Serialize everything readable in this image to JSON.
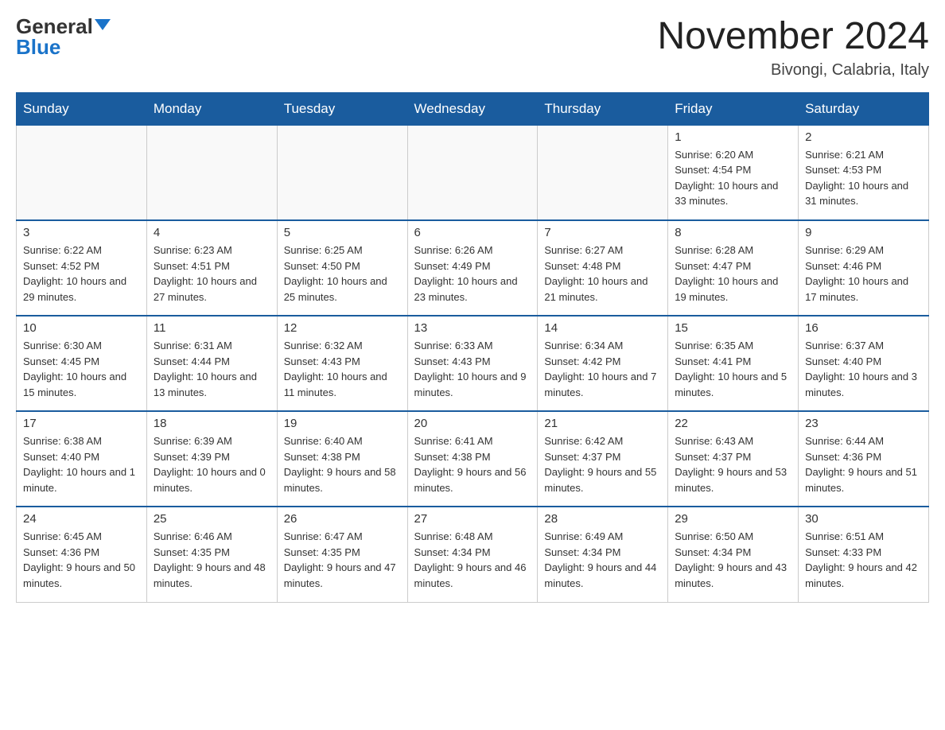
{
  "header": {
    "logo_general": "General",
    "logo_blue": "Blue",
    "month_title": "November 2024",
    "location": "Bivongi, Calabria, Italy"
  },
  "days_of_week": [
    "Sunday",
    "Monday",
    "Tuesday",
    "Wednesday",
    "Thursday",
    "Friday",
    "Saturday"
  ],
  "weeks": [
    [
      {
        "day": "",
        "info": ""
      },
      {
        "day": "",
        "info": ""
      },
      {
        "day": "",
        "info": ""
      },
      {
        "day": "",
        "info": ""
      },
      {
        "day": "",
        "info": ""
      },
      {
        "day": "1",
        "info": "Sunrise: 6:20 AM\nSunset: 4:54 PM\nDaylight: 10 hours and 33 minutes."
      },
      {
        "day": "2",
        "info": "Sunrise: 6:21 AM\nSunset: 4:53 PM\nDaylight: 10 hours and 31 minutes."
      }
    ],
    [
      {
        "day": "3",
        "info": "Sunrise: 6:22 AM\nSunset: 4:52 PM\nDaylight: 10 hours and 29 minutes."
      },
      {
        "day": "4",
        "info": "Sunrise: 6:23 AM\nSunset: 4:51 PM\nDaylight: 10 hours and 27 minutes."
      },
      {
        "day": "5",
        "info": "Sunrise: 6:25 AM\nSunset: 4:50 PM\nDaylight: 10 hours and 25 minutes."
      },
      {
        "day": "6",
        "info": "Sunrise: 6:26 AM\nSunset: 4:49 PM\nDaylight: 10 hours and 23 minutes."
      },
      {
        "day": "7",
        "info": "Sunrise: 6:27 AM\nSunset: 4:48 PM\nDaylight: 10 hours and 21 minutes."
      },
      {
        "day": "8",
        "info": "Sunrise: 6:28 AM\nSunset: 4:47 PM\nDaylight: 10 hours and 19 minutes."
      },
      {
        "day": "9",
        "info": "Sunrise: 6:29 AM\nSunset: 4:46 PM\nDaylight: 10 hours and 17 minutes."
      }
    ],
    [
      {
        "day": "10",
        "info": "Sunrise: 6:30 AM\nSunset: 4:45 PM\nDaylight: 10 hours and 15 minutes."
      },
      {
        "day": "11",
        "info": "Sunrise: 6:31 AM\nSunset: 4:44 PM\nDaylight: 10 hours and 13 minutes."
      },
      {
        "day": "12",
        "info": "Sunrise: 6:32 AM\nSunset: 4:43 PM\nDaylight: 10 hours and 11 minutes."
      },
      {
        "day": "13",
        "info": "Sunrise: 6:33 AM\nSunset: 4:43 PM\nDaylight: 10 hours and 9 minutes."
      },
      {
        "day": "14",
        "info": "Sunrise: 6:34 AM\nSunset: 4:42 PM\nDaylight: 10 hours and 7 minutes."
      },
      {
        "day": "15",
        "info": "Sunrise: 6:35 AM\nSunset: 4:41 PM\nDaylight: 10 hours and 5 minutes."
      },
      {
        "day": "16",
        "info": "Sunrise: 6:37 AM\nSunset: 4:40 PM\nDaylight: 10 hours and 3 minutes."
      }
    ],
    [
      {
        "day": "17",
        "info": "Sunrise: 6:38 AM\nSunset: 4:40 PM\nDaylight: 10 hours and 1 minute."
      },
      {
        "day": "18",
        "info": "Sunrise: 6:39 AM\nSunset: 4:39 PM\nDaylight: 10 hours and 0 minutes."
      },
      {
        "day": "19",
        "info": "Sunrise: 6:40 AM\nSunset: 4:38 PM\nDaylight: 9 hours and 58 minutes."
      },
      {
        "day": "20",
        "info": "Sunrise: 6:41 AM\nSunset: 4:38 PM\nDaylight: 9 hours and 56 minutes."
      },
      {
        "day": "21",
        "info": "Sunrise: 6:42 AM\nSunset: 4:37 PM\nDaylight: 9 hours and 55 minutes."
      },
      {
        "day": "22",
        "info": "Sunrise: 6:43 AM\nSunset: 4:37 PM\nDaylight: 9 hours and 53 minutes."
      },
      {
        "day": "23",
        "info": "Sunrise: 6:44 AM\nSunset: 4:36 PM\nDaylight: 9 hours and 51 minutes."
      }
    ],
    [
      {
        "day": "24",
        "info": "Sunrise: 6:45 AM\nSunset: 4:36 PM\nDaylight: 9 hours and 50 minutes."
      },
      {
        "day": "25",
        "info": "Sunrise: 6:46 AM\nSunset: 4:35 PM\nDaylight: 9 hours and 48 minutes."
      },
      {
        "day": "26",
        "info": "Sunrise: 6:47 AM\nSunset: 4:35 PM\nDaylight: 9 hours and 47 minutes."
      },
      {
        "day": "27",
        "info": "Sunrise: 6:48 AM\nSunset: 4:34 PM\nDaylight: 9 hours and 46 minutes."
      },
      {
        "day": "28",
        "info": "Sunrise: 6:49 AM\nSunset: 4:34 PM\nDaylight: 9 hours and 44 minutes."
      },
      {
        "day": "29",
        "info": "Sunrise: 6:50 AM\nSunset: 4:34 PM\nDaylight: 9 hours and 43 minutes."
      },
      {
        "day": "30",
        "info": "Sunrise: 6:51 AM\nSunset: 4:33 PM\nDaylight: 9 hours and 42 minutes."
      }
    ]
  ]
}
